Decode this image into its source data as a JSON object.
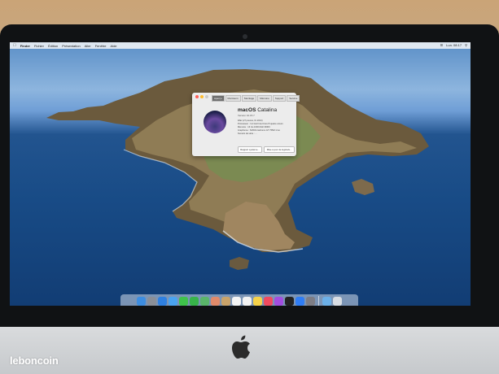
{
  "menubar": {
    "apple_icon": "apple-icon",
    "items": [
      "Finder",
      "Fichier",
      "Édition",
      "Présentation",
      "Aller",
      "Fenêtre",
      "Aide"
    ],
    "clock": "Lun. 08:17"
  },
  "about_window": {
    "tabs": [
      "Aperçu",
      "Moniteurs",
      "Stockage",
      "Mémoire",
      "Support",
      "Service"
    ],
    "active_tab": "Aperçu",
    "title_bold": "macOS",
    "title_light": "Catalina",
    "version": "Version 10.15.7",
    "specs": [
      "iMac (27 pouces, fin 2013)",
      "Processeur : 3,2 GHz Intel Core i5 quatre cœurs",
      "Mémoire : 16 Go 1600 MHz DDR3",
      "Graphisme : NVIDIA GeForce GT 755M 1 Go",
      "Numéro de série : ..."
    ],
    "buttons": [
      "Rapport système...",
      "Mise à jour de logiciels..."
    ]
  },
  "dock": {
    "icons": [
      "finder-icon",
      "launchpad-icon",
      "safari-icon",
      "mail-icon",
      "messages-icon",
      "facetime-icon",
      "maps-icon",
      "photos-icon",
      "contacts-icon",
      "calendar-icon",
      "reminders-icon",
      "notes-icon",
      "music-icon",
      "podcasts-icon",
      "tv-icon",
      "app-store-icon",
      "system-preferences-icon",
      "downloads-folder-icon",
      "trash-icon"
    ],
    "colors": [
      "#3d8de0",
      "#8a8f98",
      "#2f80e0",
      "#4aa3f0",
      "#3fc24b",
      "#37b34a",
      "#5ab56a",
      "#e08a6a",
      "#c9a36a",
      "#f4f4f4",
      "#f2f2f2",
      "#f5d24a",
      "#f04a5f",
      "#a24de0",
      "#222222",
      "#2f7df5",
      "#7d7d85",
      "#6cb0e8",
      "#d8dde3"
    ]
  },
  "watermark": "leboncoin"
}
